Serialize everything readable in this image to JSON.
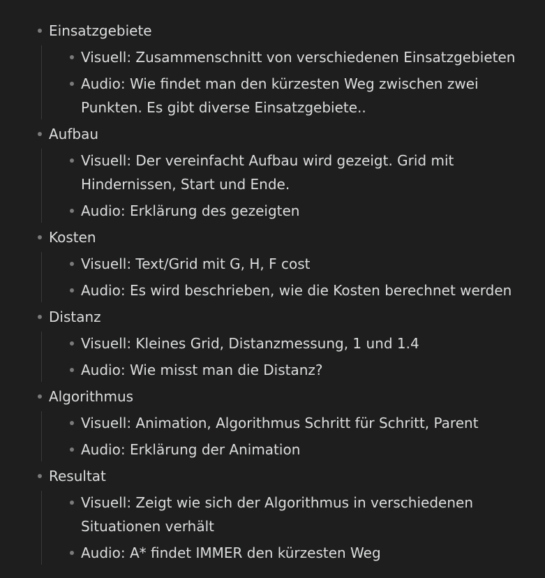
{
  "sections": [
    {
      "title": "Einsatzgebiete",
      "items": [
        "Visuell: Zusammenschnitt von verschiedenen Einsatzgebieten",
        "Audio: Wie findet man den kürzesten Weg zwischen zwei Punkten. Es gibt diverse Einsatzgebiete.."
      ]
    },
    {
      "title": "Aufbau",
      "items": [
        "Visuell: Der vereinfacht Aufbau wird gezeigt. Grid mit Hindernissen, Start und Ende.",
        "Audio: Erklärung des gezeigten"
      ]
    },
    {
      "title": "Kosten",
      "items": [
        "Visuell: Text/Grid mit G, H, F cost",
        "Audio: Es wird beschrieben, wie die Kosten berechnet werden"
      ]
    },
    {
      "title": "Distanz",
      "items": [
        "Visuell: Kleines Grid, Distanzmessung, 1 und 1.4",
        "Audio: Wie misst man die Distanz?"
      ]
    },
    {
      "title": "Algorithmus",
      "items": [
        "Visuell: Animation, Algorithmus Schritt für Schritt, Parent",
        "Audio: Erklärung der Animation"
      ]
    },
    {
      "title": "Resultat",
      "items": [
        "Visuell: Zeigt wie sich der Algorithmus in verschiedenen Situationen verhält",
        "Audio: A* findet IMMER den kürzesten Weg"
      ]
    }
  ]
}
